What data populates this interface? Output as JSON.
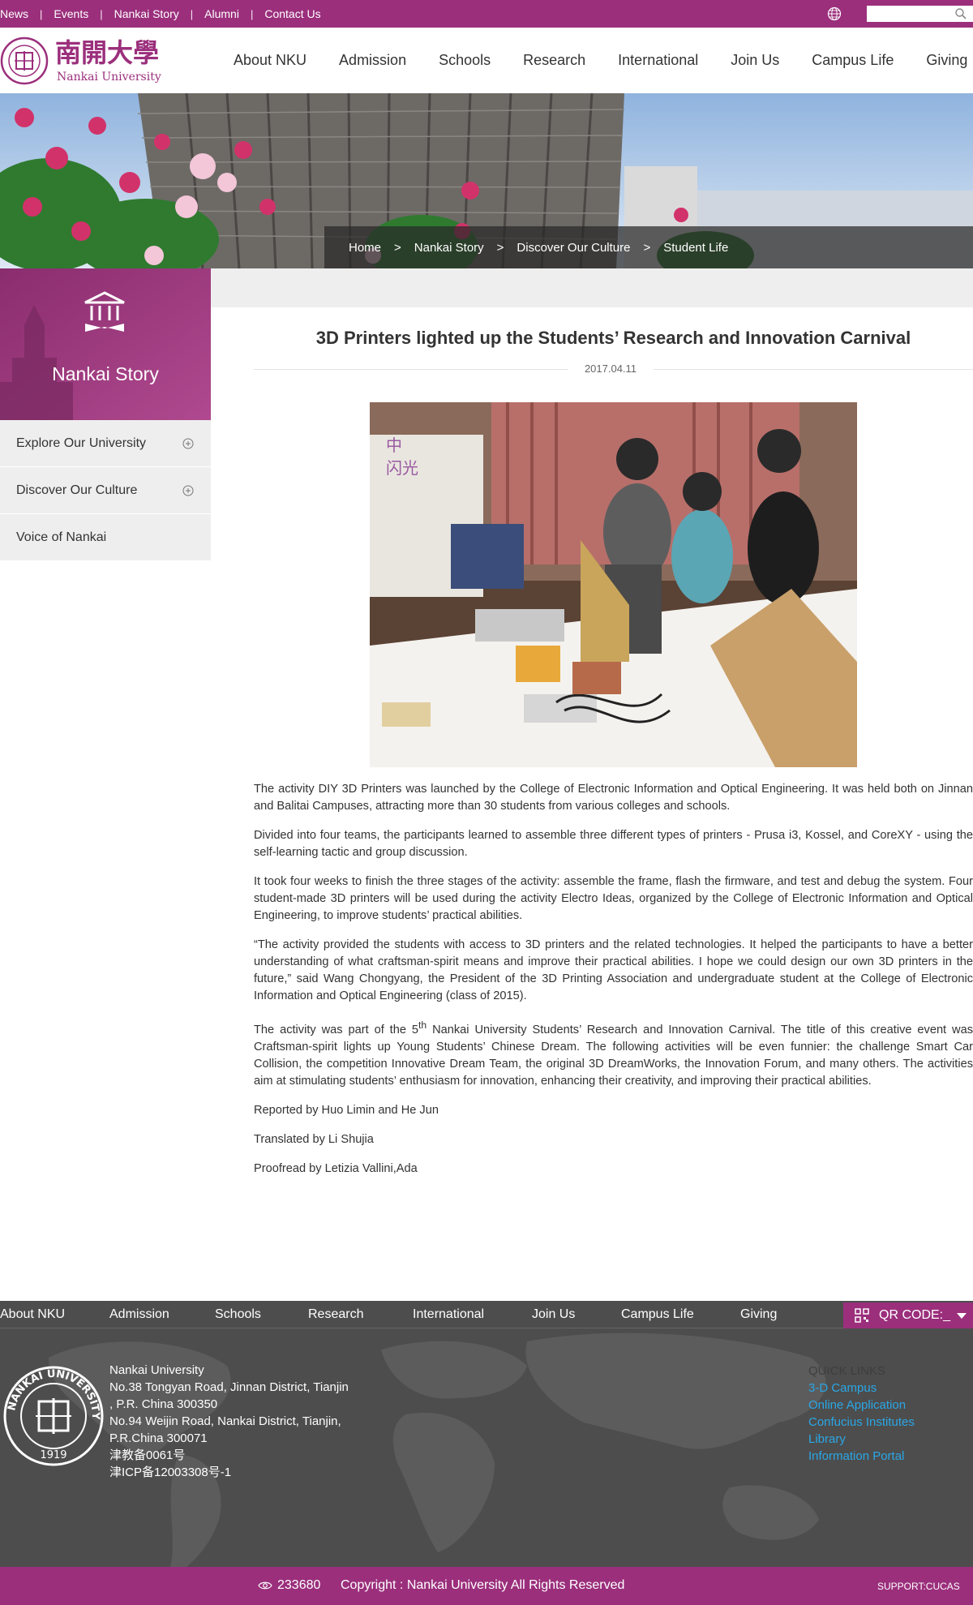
{
  "topbar": {
    "links": [
      "News",
      "Events",
      "Nankai Story",
      "Alumni",
      "Contact Us"
    ],
    "search_placeholder": ""
  },
  "logo": {
    "chinese_name": "南開大學",
    "english_name": "Nankai University"
  },
  "nav": [
    "About NKU",
    "Admission",
    "Schools",
    "Research",
    "International",
    "Join Us",
    "Campus Life",
    "Giving"
  ],
  "breadcrumb": {
    "items": [
      "Home",
      "Nankai Story",
      "Discover Our Culture"
    ],
    "current": "Student Life",
    "separator": ">"
  },
  "sidebar": {
    "title": "Nankai Story",
    "items": [
      {
        "label": "Explore Our University",
        "expandable": true
      },
      {
        "label": "Discover Our Culture",
        "expandable": true
      },
      {
        "label": "Voice of Nankai",
        "expandable": false
      }
    ]
  },
  "article": {
    "title": "3D Printers lighted up the Students’ Research and Innovation Carnival",
    "date": "2017.04.11",
    "paragraphs": [
      "The activity DIY 3D Printers was launched by the College of Electronic Information and Optical Engineering. It was held both on Jinnan and Balitai Campuses, attracting more than 30 students from various colleges and schools.",
      "Divided into four teams, the participants learned to assemble three different types of printers - Prusa i3, Kossel, and CoreXY - using the self-learning tactic and group discussion.",
      "It took four weeks to finish the three stages of the activity: assemble the frame, flash the firmware, and test and debug the system. Four student-made 3D printers will be used during the activity Electro Ideas, organized by the College of Electronic Information and Optical Engineering, to improve students’ practical abilities.",
      "“The activity provided the students with access to 3D printers and the related technologies. It helped the participants to have a better understanding of what craftsman-spirit means and improve their practical abilities. I hope we could design our own 3D printers in the future,” said Wang Chongyang, the President of the 3D Printing Association and undergraduate student at the College of Electronic Information and Optical Engineering (class of 2015)."
    ],
    "p5_before": "The activity was part of the 5",
    "p5_sup": "th",
    "p5_after": " Nankai University Students’ Research and Innovation Carnival. The title of this creative event was Craftsman-spirit lights up Young Students’ Chinese Dream. The following activities will be even funnier: the challenge Smart Car Collision, the competition Innovative Dream Team, the original 3D DreamWorks, the Innovation Forum, and many others. The activities aim at stimulating students’ enthusiasm for innovation, enhancing their creativity, and improving their practical abilities.",
    "credits": [
      "Reported by Huo Limin and He Jun",
      "Translated by Li Shujia",
      "Proofread by Letizia Vallini,Ada"
    ]
  },
  "footer": {
    "nav": [
      "About NKU",
      "Admission",
      "Schools",
      "Research",
      "International",
      "Join Us",
      "Campus Life",
      "Giving"
    ],
    "qr_label": "QR CODE:_",
    "address_lines": [
      "Nankai University",
      "No.38 Tongyan Road, Jinnan District, Tianjin",
      ", P.R. China 300350",
      "No.94 Weijin Road,  Nankai District, Tianjin,",
      "P.R.China  300071",
      "津教备0061号",
      "津ICP备12003308号-1"
    ],
    "quick_links_title": "QUICK LINKS",
    "quick_links": [
      "3-D Campus",
      "Online Application",
      "Confucius Institutes",
      "Library",
      "Information Portal"
    ],
    "seal_text": "NANKAI UNIVERSITY",
    "seal_year": "1919"
  },
  "bottom": {
    "views": "233680",
    "copyright": "Copyright : Nankai University All Rights Reserved",
    "support": "SUPPORT:CUCAS"
  },
  "colors": {
    "brand": "#9b2f7c",
    "footer": "#4d4d4d",
    "link": "#2aa7e6"
  }
}
